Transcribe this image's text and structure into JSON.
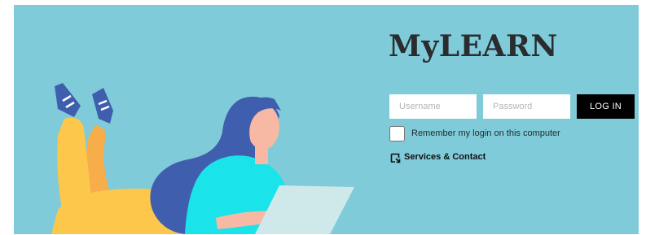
{
  "brand": {
    "logo_text": "MyLEARN"
  },
  "login": {
    "username_placeholder": "Username",
    "password_placeholder": "Password",
    "login_label": "LOG IN",
    "remember_label": "Remember my login on this computer"
  },
  "links": {
    "services_label": "Services & Contact",
    "services_icon": "external-link-icon"
  },
  "colors": {
    "background": "#80cbd9",
    "button": "#000000",
    "hair": "#3f5fae",
    "shirt": "#1ae3e9",
    "pants": "#fcc74a",
    "skin": "#f7b9a3",
    "laptop": "#cfe9ea"
  }
}
